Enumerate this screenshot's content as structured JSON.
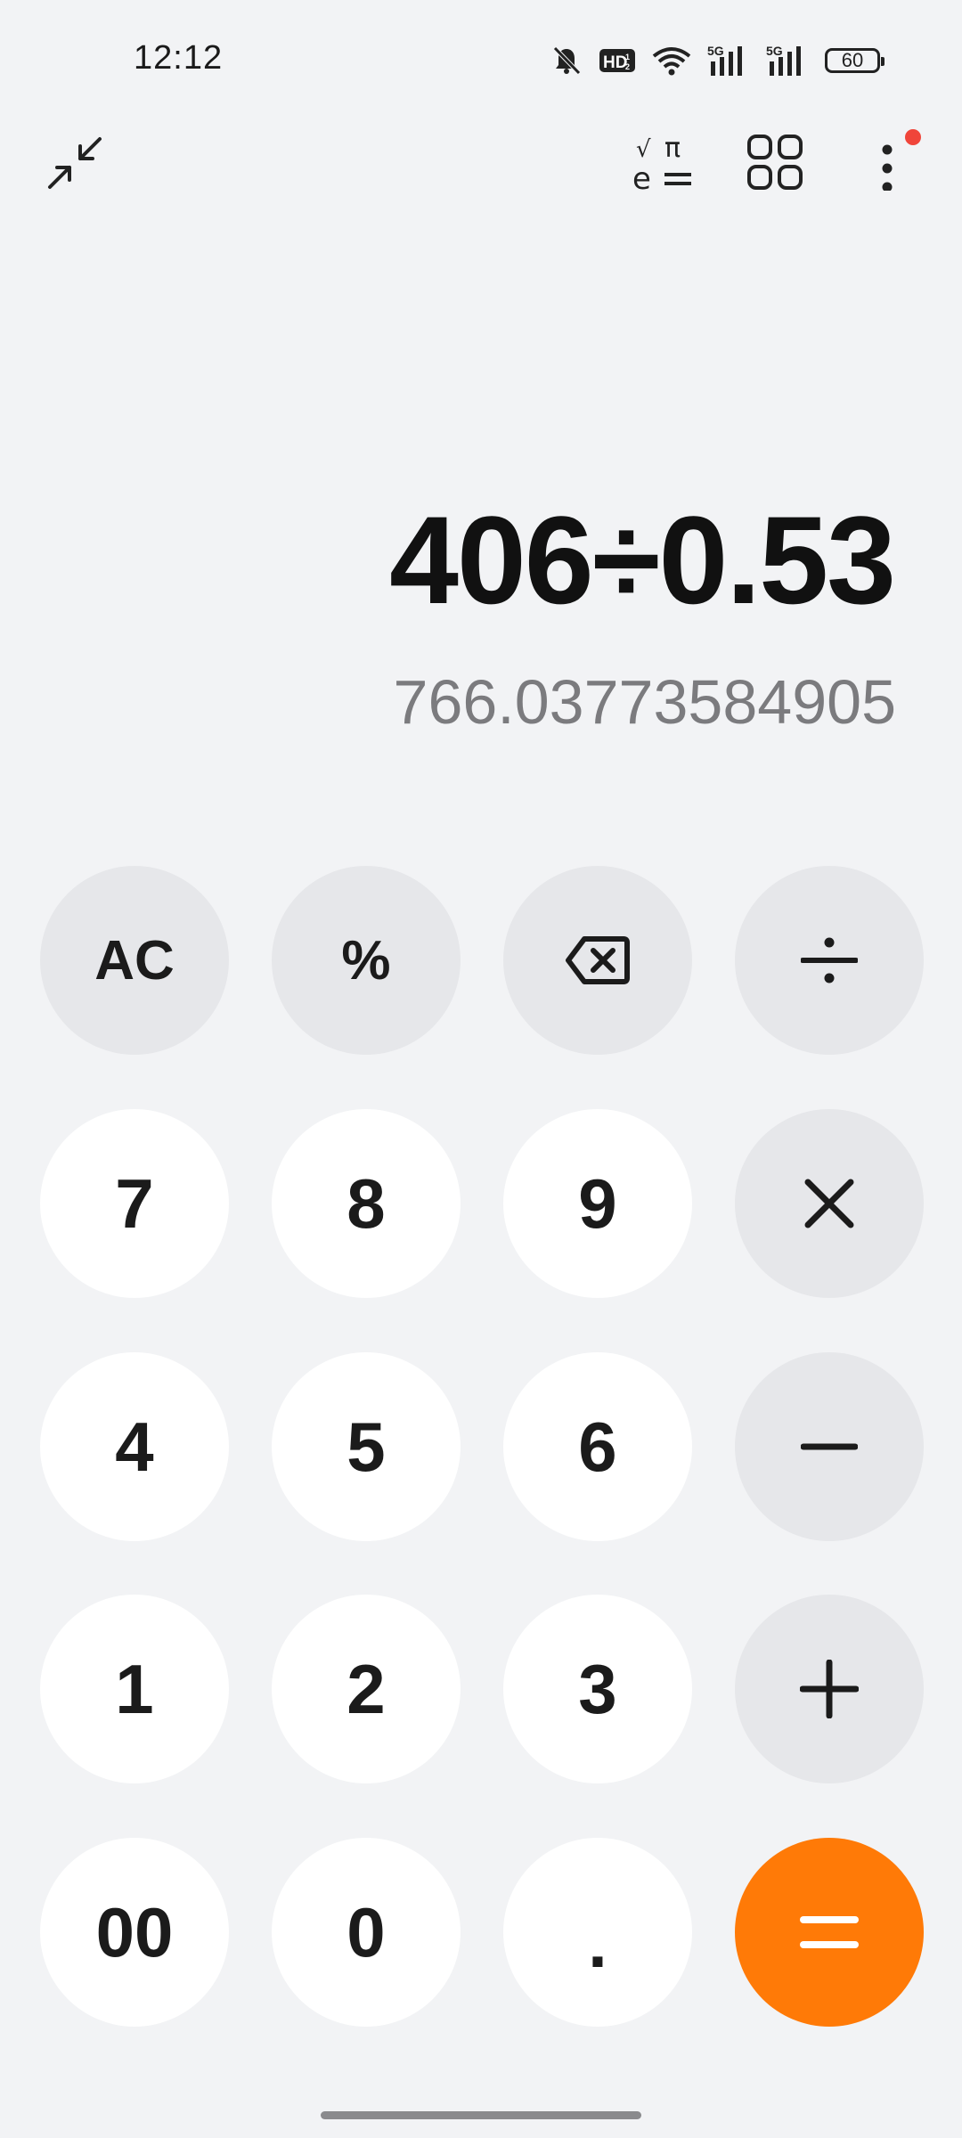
{
  "status_bar": {
    "time": "12:12",
    "hd_label": "HD",
    "network_1": "5G",
    "network_2": "5G",
    "battery": "60",
    "icons": [
      "mute-bell-icon",
      "hd-icon",
      "wifi-icon",
      "signal-5g-icon",
      "signal-5g-icon",
      "battery-icon"
    ]
  },
  "toolbar": {
    "collapse_icon": "collapse-arrows-icon",
    "scientific_icon": "scientific-mode-icon",
    "scientific_symbols": {
      "sqrt": "√",
      "pi": "π",
      "e": "e"
    },
    "converter_icon": "grid-squares-icon",
    "more_icon": "more-vertical-icon",
    "more_has_notification": true
  },
  "display": {
    "expression": "406÷0.53",
    "result": "766.03773584905"
  },
  "keypad": {
    "rows": [
      [
        "AC",
        "%",
        "backspace",
        "÷"
      ],
      [
        "7",
        "8",
        "9",
        "×"
      ],
      [
        "4",
        "5",
        "6",
        "−"
      ],
      [
        "1",
        "2",
        "3",
        "+"
      ],
      [
        "00",
        "0",
        ".",
        "="
      ]
    ],
    "labels": {
      "ac": "AC",
      "percent": "%",
      "seven": "7",
      "eight": "8",
      "nine": "9",
      "four": "4",
      "five": "5",
      "six": "6",
      "one": "1",
      "two": "2",
      "three": "3",
      "double_zero": "00",
      "zero": "0",
      "decimal": "."
    }
  },
  "colors": {
    "background": "#f2f3f5",
    "number_key": "#ffffff",
    "function_key": "#e6e7ea",
    "equals_key": "#ff7a07",
    "result_text": "#7b7b7e",
    "notification_dot": "#f0453a"
  }
}
